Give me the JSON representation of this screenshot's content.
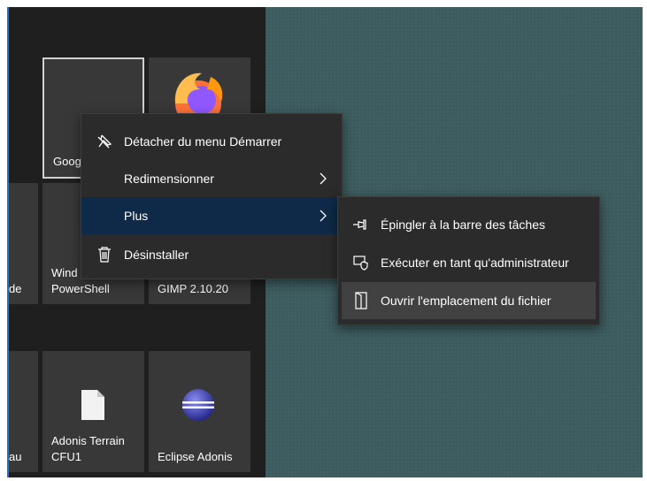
{
  "tiles": [
    {
      "label": "Goog",
      "selected": true
    },
    {
      "label": "",
      "icon": "firefox-icon"
    },
    {
      "label": "de"
    },
    {
      "label": "Wind\nPowerShell"
    },
    {
      "label": "GIMP 2.10.20"
    },
    {
      "label": "au"
    },
    {
      "label": "Adonis Terrain\nCFU1",
      "icon": "document-icon"
    },
    {
      "label": "Eclipse Adonis",
      "icon": "eclipse-icon"
    }
  ],
  "context_menu": {
    "items": [
      {
        "label": "Détacher du menu Démarrer",
        "icon": "unpin-icon"
      },
      {
        "label": "Redimensionner",
        "has_submenu": true
      },
      {
        "label": "Plus",
        "has_submenu": true,
        "highlighted": true
      },
      {
        "label": "Désinstaller",
        "icon": "trash-icon"
      }
    ]
  },
  "submenu": {
    "items": [
      {
        "label": "Épingler à la barre des tâches",
        "icon": "pin-icon"
      },
      {
        "label": "Exécuter en tant qu'administrateur",
        "icon": "shield-icon"
      },
      {
        "label": "Ouvrir l'emplacement du fichier",
        "icon": "folder-open-icon",
        "hovered": true
      }
    ]
  },
  "colors": {
    "accent": "#0e2a48",
    "desktop": "#3d5c5f",
    "menu_bg": "#2b2b2b"
  }
}
